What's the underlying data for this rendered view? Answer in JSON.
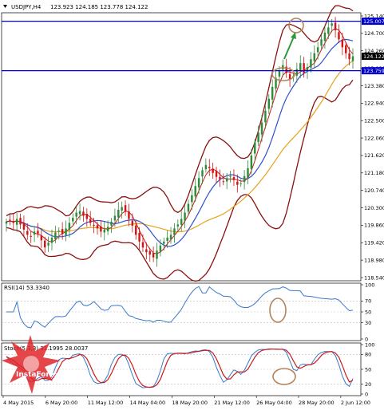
{
  "header": {
    "symbol": "USDJPY,H4",
    "ohlc": "123.923 124.185 123.778 124.122"
  },
  "colors": {
    "bull": "#2e8b3a",
    "bear": "#d11414",
    "bollinger": "#8b0f0f",
    "ma_fast": "#cc1b1b",
    "ma_mid": "#2f4fd0",
    "ma_slow": "#e6a21a",
    "hline": "#0000cc",
    "rsi": "#3a78c9",
    "stoch_main": "#3a78c9",
    "stoch_signal": "#cc1b1b",
    "annotation": "#b5835a",
    "arrow": "#2e9a3e"
  },
  "price_panel": {
    "y_ticks": [
      "125.140",
      "124.700",
      "124.260",
      "123.820",
      "123.380",
      "122.940",
      "122.500",
      "122.060",
      "121.620",
      "121.180",
      "120.740",
      "120.300",
      "119.860",
      "119.420",
      "118.980",
      "118.540"
    ],
    "hline_upper": 125.007,
    "hline_upper_label": "125.007",
    "hline_lower": 123.759,
    "hline_lower_label": "123.759",
    "current_price": 124.122,
    "current_price_label": "124.122"
  },
  "rsi_panel": {
    "label": "RSI(14) 53.3340",
    "y_ticks": [
      "100",
      "70",
      "50",
      "30",
      "0"
    ],
    "last_value": 53.334
  },
  "stoch_panel": {
    "label": "Stoch(5,3,3) 31.1995 28.0037",
    "y_ticks": [
      "100",
      "80",
      "50",
      "20",
      "0"
    ],
    "main_last": 31.1995,
    "signal_last": 28.0037
  },
  "x_axis": {
    "labels": [
      "4 May 2015",
      "6 May 20:00",
      "11 May 12:00",
      "14 May 04:00",
      "18 May 20:00",
      "21 May 12:00",
      "26 May 04:00",
      "28 May 20:00",
      "2 Jun 12:00"
    ]
  },
  "watermark": {
    "brand": "InstaForex"
  },
  "chart_data": {
    "type": "candlestick",
    "instrument": "USDJPY",
    "timeframe": "H4",
    "categories": [
      "4 May 2015",
      "6 May 20:00",
      "11 May 12:00",
      "14 May 04:00",
      "18 May 20:00",
      "21 May 12:00",
      "26 May 04:00",
      "28 May 20:00",
      "2 Jun 12:00"
    ],
    "close": [
      119.95,
      119.98,
      119.92,
      120.02,
      119.88,
      119.75,
      119.62,
      119.58,
      119.7,
      119.65,
      119.48,
      119.3,
      119.42,
      119.55,
      119.68,
      119.72,
      119.64,
      119.78,
      119.92,
      120.05,
      120.18,
      120.22,
      120.1,
      120.02,
      119.92,
      119.85,
      119.78,
      119.7,
      119.75,
      119.82,
      119.95,
      120.1,
      120.25,
      120.32,
      120.2,
      120.02,
      119.85,
      119.62,
      119.45,
      119.3,
      119.18,
      119.12,
      119.05,
      119.22,
      119.35,
      119.45,
      119.55,
      119.62,
      119.78,
      119.88,
      120.02,
      120.18,
      120.4,
      120.62,
      120.85,
      121.05,
      121.25,
      121.38,
      121.3,
      121.18,
      121.08,
      121.02,
      120.95,
      121.05,
      121.1,
      121.0,
      120.88,
      120.92,
      121.1,
      121.3,
      121.62,
      121.95,
      122.2,
      122.45,
      122.75,
      123.05,
      123.35,
      123.58,
      123.75,
      123.9,
      123.7,
      123.55,
      123.62,
      123.8,
      123.95,
      123.7,
      123.85,
      124.05,
      124.2,
      124.35,
      124.55,
      124.72,
      124.85,
      124.95,
      124.78,
      124.55,
      124.35,
      124.2,
      124.05,
      124.122
    ],
    "ylim": [
      118.54,
      125.14
    ],
    "horizontal_levels": [
      125.007,
      123.759
    ],
    "rsi": {
      "name": "RSI(14)",
      "last": 53.334,
      "ylim": [
        0,
        100
      ],
      "levels": [
        70,
        50,
        30
      ]
    },
    "stochastic": {
      "name": "Stoch(5,3,3)",
      "main_last": 31.1995,
      "signal_last": 28.0037,
      "ylim": [
        0,
        100
      ],
      "levels": [
        80,
        50,
        20
      ]
    }
  }
}
